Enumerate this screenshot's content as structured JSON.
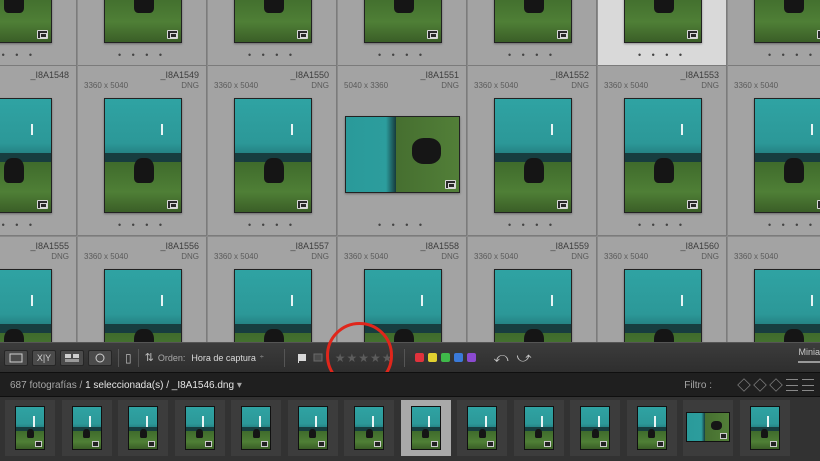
{
  "grid": {
    "rows": [
      {
        "cells": [
          {
            "name": "",
            "dimensions": "",
            "format": "",
            "orientation": "portrait"
          },
          {
            "name": "",
            "dimensions": "",
            "format": "",
            "orientation": "portrait"
          },
          {
            "name": "",
            "dimensions": "",
            "format": "",
            "orientation": "portrait"
          },
          {
            "name": "",
            "dimensions": "",
            "format": "",
            "orientation": "portrait"
          },
          {
            "name": "",
            "dimensions": "",
            "format": "",
            "orientation": "portrait"
          },
          {
            "name": "",
            "dimensions": "",
            "format": "",
            "orientation": "portrait",
            "selected": true
          },
          {
            "name": "",
            "dimensions": "",
            "format": "",
            "orientation": "portrait"
          }
        ]
      },
      {
        "cells": [
          {
            "name": "_I8A1548",
            "dimensions": "",
            "format": "",
            "orientation": "portrait"
          },
          {
            "name": "_I8A1549",
            "dimensions": "3360 x 5040",
            "format": "DNG",
            "orientation": "portrait"
          },
          {
            "name": "_I8A1550",
            "dimensions": "3360 x 5040",
            "format": "DNG",
            "orientation": "portrait"
          },
          {
            "name": "_I8A1551",
            "dimensions": "5040 x 3360",
            "format": "DNG",
            "orientation": "landscape"
          },
          {
            "name": "_I8A1552",
            "dimensions": "3360 x 5040",
            "format": "DNG",
            "orientation": "portrait"
          },
          {
            "name": "_I8A1553",
            "dimensions": "3360 x 5040",
            "format": "DNG",
            "orientation": "portrait"
          },
          {
            "name": "",
            "dimensions": "3360 x 5040",
            "format": "",
            "orientation": "portrait"
          }
        ]
      },
      {
        "cells": [
          {
            "name": "_I8A1555",
            "dimensions": "",
            "format": "DNG",
            "orientation": "portrait"
          },
          {
            "name": "_I8A1556",
            "dimensions": "3360 x 5040",
            "format": "DNG",
            "orientation": "portrait"
          },
          {
            "name": "_I8A1557",
            "dimensions": "3360 x 5040",
            "format": "DNG",
            "orientation": "portrait"
          },
          {
            "name": "_I8A1558",
            "dimensions": "3360 x 5040",
            "format": "DNG",
            "orientation": "portrait"
          },
          {
            "name": "_I8A1559",
            "dimensions": "3360 x 5040",
            "format": "DNG",
            "orientation": "portrait"
          },
          {
            "name": "_I8A1560",
            "dimensions": "3360 x 5040",
            "format": "DNG",
            "orientation": "portrait"
          },
          {
            "name": "",
            "dimensions": "3360 x 5040",
            "format": "",
            "orientation": "portrait"
          }
        ]
      }
    ],
    "dots": "• • • •"
  },
  "toolbar": {
    "view_buttons": [
      "grid-view-icon",
      "loupe-view-icon",
      "compare-view-icon",
      "survey-view-icon",
      "people-view-icon"
    ],
    "sort_label": "Orden:",
    "sort_value": "Hora de captura",
    "sort_caret": "÷",
    "stars": "★★★★★",
    "color_labels": [
      "#e0323c",
      "#e2d130",
      "#3fb94a",
      "#3a7ad9",
      "#8b4ad0"
    ],
    "rotate_left": "⤺",
    "rotate_right": "⤻",
    "thumb_size_label": "Minia"
  },
  "filmbar": {
    "count": "687 fotografías /",
    "selection": "1 seleccionada(s)",
    "file": "/ _I8A1546.dng",
    "caret": "▾",
    "filter_label": "Filtro :"
  },
  "filmstrip": {
    "items": [
      {
        "orientation": "portrait"
      },
      {
        "orientation": "portrait"
      },
      {
        "orientation": "portrait"
      },
      {
        "orientation": "portrait"
      },
      {
        "orientation": "portrait"
      },
      {
        "orientation": "portrait"
      },
      {
        "orientation": "portrait"
      },
      {
        "orientation": "portrait",
        "selected": true
      },
      {
        "orientation": "portrait"
      },
      {
        "orientation": "portrait"
      },
      {
        "orientation": "portrait"
      },
      {
        "orientation": "portrait"
      },
      {
        "orientation": "landscape"
      },
      {
        "orientation": "portrait"
      }
    ]
  }
}
